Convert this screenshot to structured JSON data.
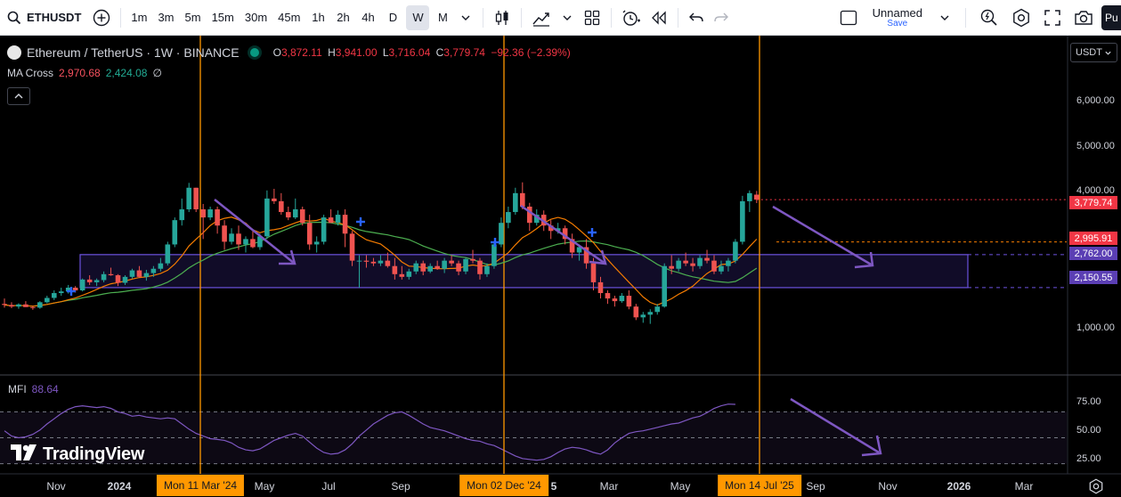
{
  "toolbar": {
    "symbol": "ETHUSDT",
    "intervals": [
      "1m",
      "3m",
      "5m",
      "15m",
      "30m",
      "45m",
      "1h",
      "2h",
      "4h",
      "D",
      "W",
      "M"
    ],
    "active_interval": "W",
    "layout_name": "Unnamed",
    "layout_status": "Save",
    "publish_label": "Pu"
  },
  "legend": {
    "symbol_name": "Ethereum / TetherUS · 1W · BINANCE",
    "open_label": "O",
    "open": "3,872.11",
    "high_label": "H",
    "high": "3,941.00",
    "low_label": "L",
    "low": "3,716.04",
    "close_label": "C",
    "close": "3,779.74",
    "change": "−92.36 (−2.39%)"
  },
  "ma_cross": {
    "name": "MA Cross",
    "fast": "2,970.68",
    "slow": "2,424.08",
    "symbol": "∅"
  },
  "mfi": {
    "name": "MFI",
    "value": "88.64"
  },
  "brand": {
    "name": "TradingView"
  },
  "currency": "USDT",
  "price_axis": {
    "labels": [
      "6,000.00",
      "5,000.00",
      "4,000.00",
      "1,000.00"
    ],
    "tags": [
      {
        "text": "3,779.74",
        "color": "#f23645"
      },
      {
        "text": "2,995.91",
        "color": "#f23645"
      },
      {
        "text": "2,762.00",
        "color": "#5b3fb4"
      },
      {
        "text": "2,150.55",
        "color": "#5b3fb4"
      }
    ]
  },
  "mfi_axis": {
    "labels": [
      "75.00",
      "50.00",
      "25.00"
    ]
  },
  "time_axis": {
    "labels": [
      "Nov",
      "2024",
      "May",
      "Jul",
      "Sep",
      "5",
      "Mar",
      "May",
      "Sep",
      "Nov",
      "2026",
      "Mar"
    ],
    "markers": [
      "Mon 11 Mar '24",
      "Mon 02 Dec '24",
      "Mon 14 Jul '25"
    ]
  },
  "colors": {
    "up": "#26a69a",
    "down": "#ef5350",
    "ma_fast": "#f57c00",
    "ma_slow": "#4caf50",
    "zone": "#6c52e0",
    "vline": "#ff9800",
    "mfi": "#7e57c2",
    "arrow": "#7e57c2"
  },
  "chart_data": {
    "type": "candlestick",
    "interval": "1W",
    "price_range": [
      550,
      6750
    ],
    "zone": [
      2150.55,
      2762.0
    ],
    "ref_lines": [
      2995.91,
      2762.0,
      2150.55
    ],
    "last_close": 3779.74,
    "mfi_levels": [
      80,
      50,
      20
    ],
    "candles": [
      [
        1850,
        1950,
        1780,
        1830
      ],
      [
        1830,
        1880,
        1770,
        1800
      ],
      [
        1800,
        1860,
        1760,
        1840
      ],
      [
        1840,
        1900,
        1800,
        1790
      ],
      [
        1790,
        1810,
        1740,
        1780
      ],
      [
        1780,
        1900,
        1760,
        1880
      ],
      [
        1880,
        2000,
        1860,
        1960
      ],
      [
        1960,
        2100,
        1920,
        2050
      ],
      [
        2050,
        2150,
        2000,
        2080
      ],
      [
        2080,
        2200,
        2040,
        2150
      ],
      [
        2150,
        2180,
        2060,
        2100
      ],
      [
        2100,
        2320,
        2080,
        2300
      ],
      [
        2300,
        2380,
        2200,
        2250
      ],
      [
        2250,
        2320,
        2180,
        2290
      ],
      [
        2290,
        2450,
        2250,
        2400
      ],
      [
        2400,
        2520,
        2370,
        2380
      ],
      [
        2380,
        2400,
        2180,
        2240
      ],
      [
        2240,
        2380,
        2200,
        2350
      ],
      [
        2350,
        2500,
        2320,
        2470
      ],
      [
        2470,
        2550,
        2340,
        2350
      ],
      [
        2350,
        2480,
        2280,
        2420
      ],
      [
        2420,
        2550,
        2350,
        2500
      ],
      [
        2500,
        2700,
        2450,
        2600
      ],
      [
        2600,
        3000,
        2560,
        2950
      ],
      [
        2950,
        3450,
        2900,
        3400
      ],
      [
        3400,
        3800,
        3300,
        3600
      ],
      [
        3600,
        4090,
        3550,
        4000
      ],
      [
        4000,
        4000,
        3550,
        3600
      ],
      [
        3600,
        3700,
        3050,
        3450
      ],
      [
        3450,
        3650,
        3400,
        3600
      ],
      [
        3600,
        3650,
        3150,
        3300
      ],
      [
        3300,
        3400,
        2850,
        3000
      ],
      [
        3000,
        3250,
        2950,
        3150
      ],
      [
        3150,
        3300,
        2850,
        2950
      ],
      [
        2950,
        3100,
        2800,
        3050
      ],
      [
        3050,
        3200,
        2880,
        2900
      ],
      [
        2900,
        3150,
        2850,
        3100
      ],
      [
        3100,
        3950,
        3050,
        3800
      ],
      [
        3800,
        3980,
        3700,
        3750
      ],
      [
        3750,
        3900,
        3500,
        3550
      ],
      [
        3550,
        3650,
        3400,
        3450
      ],
      [
        3450,
        3800,
        3420,
        3600
      ],
      [
        3600,
        3650,
        3300,
        3350
      ],
      [
        3350,
        3500,
        2850,
        2950
      ],
      [
        2950,
        3100,
        2800,
        3000
      ],
      [
        3000,
        3500,
        2950,
        3450
      ],
      [
        3450,
        3600,
        3350,
        3350
      ],
      [
        3350,
        3580,
        3300,
        3500
      ],
      [
        3500,
        3600,
        2900,
        3150
      ],
      [
        3150,
        3200,
        2550,
        2650
      ],
      [
        2650,
        2750,
        2150,
        2650
      ],
      [
        2650,
        2750,
        2520,
        2630
      ],
      [
        2630,
        2700,
        2550,
        2600
      ],
      [
        2600,
        2750,
        2550,
        2650
      ],
      [
        2650,
        2800,
        2520,
        2550
      ],
      [
        2550,
        2700,
        2300,
        2400
      ],
      [
        2400,
        2550,
        2300,
        2350
      ],
      [
        2350,
        2500,
        2300,
        2450
      ],
      [
        2450,
        2650,
        2400,
        2600
      ],
      [
        2600,
        2650,
        2380,
        2450
      ],
      [
        2450,
        2600,
        2420,
        2550
      ],
      [
        2550,
        2650,
        2480,
        2500
      ],
      [
        2500,
        2700,
        2420,
        2650
      ],
      [
        2650,
        2750,
        2550,
        2600
      ],
      [
        2600,
        2650,
        2380,
        2450
      ],
      [
        2450,
        2700,
        2400,
        2680
      ],
      [
        2680,
        2850,
        2600,
        2650
      ],
      [
        2650,
        2700,
        2300,
        2400
      ],
      [
        2400,
        2600,
        2350,
        2550
      ],
      [
        2550,
        3000,
        2500,
        2950
      ],
      [
        2950,
        3450,
        2900,
        3350
      ],
      [
        3350,
        3650,
        3250,
        3550
      ],
      [
        3550,
        4000,
        3500,
        3900
      ],
      [
        3900,
        4100,
        3600,
        3650
      ],
      [
        3650,
        3720,
        3200,
        3350
      ],
      [
        3350,
        3600,
        3300,
        3500
      ],
      [
        3500,
        3580,
        3200,
        3300
      ],
      [
        3300,
        3400,
        3050,
        3200
      ],
      [
        3200,
        3350,
        3150,
        3250
      ],
      [
        3250,
        3300,
        2950,
        3050
      ],
      [
        3050,
        3150,
        2700,
        2800
      ],
      [
        2800,
        2950,
        2650,
        2900
      ],
      [
        2900,
        3050,
        2500,
        2600
      ],
      [
        2600,
        2700,
        2100,
        2250
      ],
      [
        2250,
        2350,
        1950,
        2050
      ],
      [
        2050,
        2100,
        1850,
        1950
      ],
      [
        1950,
        2000,
        1800,
        1900
      ],
      [
        1900,
        2050,
        1870,
        2000
      ],
      [
        2000,
        2100,
        1750,
        1800
      ],
      [
        1800,
        1850,
        1550,
        1600
      ],
      [
        1600,
        1700,
        1500,
        1650
      ],
      [
        1650,
        1750,
        1480,
        1700
      ],
      [
        1700,
        1850,
        1650,
        1800
      ],
      [
        1800,
        2600,
        1780,
        2550
      ],
      [
        2550,
        2750,
        2400,
        2500
      ],
      [
        2500,
        2700,
        2450,
        2650
      ],
      [
        2650,
        2800,
        2550,
        2600
      ],
      [
        2600,
        2700,
        2450,
        2550
      ],
      [
        2550,
        2750,
        2500,
        2700
      ],
      [
        2700,
        2850,
        2600,
        2650
      ],
      [
        2650,
        2750,
        2400,
        2450
      ],
      [
        2450,
        2650,
        2400,
        2550
      ],
      [
        2550,
        2700,
        2450,
        2650
      ],
      [
        2650,
        3050,
        2600,
        3000
      ],
      [
        3000,
        3850,
        2950,
        3750
      ],
      [
        3750,
        3950,
        3550,
        3900
      ],
      [
        3872.11,
        3941.0,
        3716.04,
        3779.74
      ]
    ],
    "mfi_values": [
      58,
      52,
      50,
      51,
      54,
      59,
      66,
      72,
      78,
      83,
      86,
      87,
      86,
      85,
      86,
      84,
      80,
      78,
      75,
      76,
      74,
      73,
      72,
      73,
      72,
      66,
      60,
      55,
      52,
      49,
      48,
      47,
      44,
      39,
      36,
      35,
      37,
      42,
      47,
      50,
      53,
      55,
      52,
      45,
      38,
      33,
      31,
      32,
      36,
      43,
      52,
      59,
      66,
      71,
      76,
      79,
      80,
      76,
      71,
      66,
      62,
      60,
      58,
      55,
      52,
      49,
      47,
      46,
      43,
      41,
      37,
      33,
      29,
      26,
      25,
      24,
      25,
      28,
      33,
      37,
      39,
      38,
      36,
      33,
      31,
      36,
      44,
      50,
      55,
      57,
      58,
      60,
      62,
      64,
      66,
      67,
      70,
      73,
      75,
      79,
      84,
      87,
      89,
      88.64
    ]
  }
}
